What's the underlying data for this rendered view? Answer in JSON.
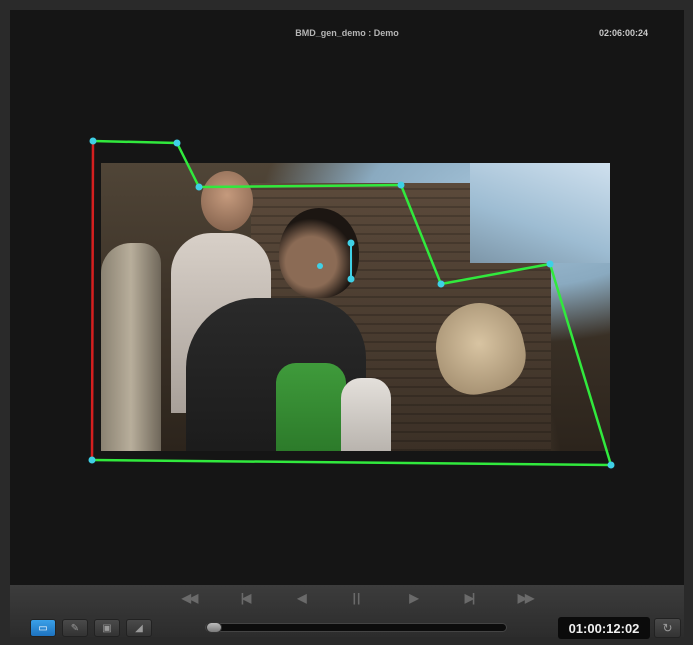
{
  "viewer": {
    "clip_title": "BMD_gen_demo : Demo",
    "source_timecode": "02:06:00:24"
  },
  "transport": {
    "rewind_icon": "fast-rewind-icon",
    "first_frame_icon": "skip-to-start-icon",
    "play_reverse_icon": "play-reverse-icon",
    "pause_icon": "pause-icon",
    "play_icon": "play-icon",
    "last_frame_icon": "skip-to-end-icon",
    "fast_forward_icon": "fast-forward-icon"
  },
  "tools": [
    {
      "name": "mask-select-tool",
      "icon": "pointer-icon",
      "active": true
    },
    {
      "name": "pen-tool",
      "icon": "pen-icon",
      "active": false
    },
    {
      "name": "monitor-tool",
      "icon": "monitor-icon",
      "active": false
    },
    {
      "name": "audio-tool",
      "icon": "speaker-icon",
      "active": false
    }
  ],
  "playhead": {
    "timecode": "01:00:12:02",
    "position_fraction": 0.0
  },
  "colors": {
    "mask_line": "#31e93d",
    "mask_edge_selected": "#d41f1f",
    "control_point": "#3fd0e6",
    "tool_active": "#2a88d8"
  }
}
